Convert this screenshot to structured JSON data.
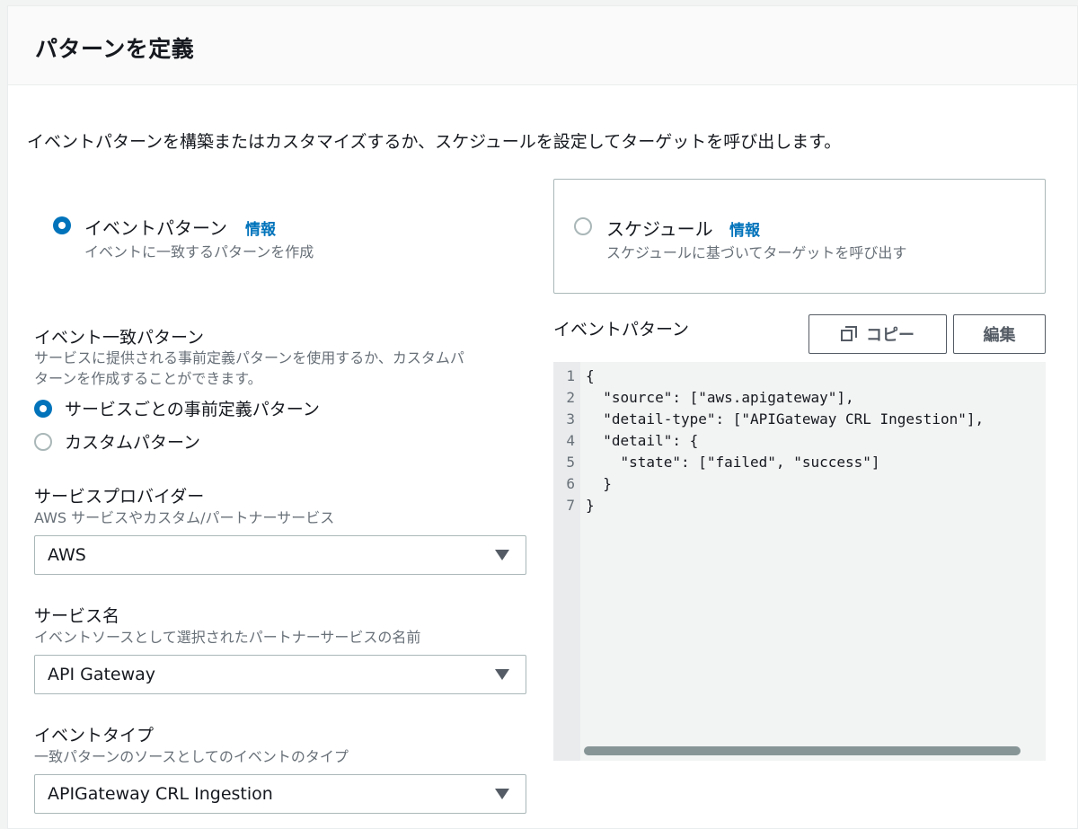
{
  "panel": {
    "title": "パターンを定義"
  },
  "intro": "イベントパターンを構築またはカスタマイズするか、スケジュールを設定してターゲットを呼び出します。",
  "tiles": {
    "event_pattern": {
      "label": "イベントパターン",
      "info": "情報",
      "desc": "イベントに一致するパターンを作成",
      "selected": true
    },
    "schedule": {
      "label": "スケジュール",
      "info": "情報",
      "desc": "スケジュールに基づいてターゲットを呼び出す",
      "selected": false
    }
  },
  "match_pattern": {
    "label": "イベント一致パターン",
    "desc_line1": "サービスに提供される事前定義パターンを使用するか、カスタムパ",
    "desc_line2": "ターンを作成することができます。",
    "options": [
      {
        "label": "サービスごとの事前定義パターン",
        "selected": true
      },
      {
        "label": "カスタムパターン",
        "selected": false
      }
    ]
  },
  "service_provider": {
    "label": "サービスプロバイダー",
    "desc": "AWS サービスやカスタム/パートナーサービス",
    "value": "AWS"
  },
  "service_name": {
    "label": "サービス名",
    "desc": "イベントソースとして選択されたパートナーサービスの名前",
    "value": "API Gateway"
  },
  "event_type": {
    "label": "イベントタイプ",
    "desc": "一致パターンのソースとしてのイベントのタイプ",
    "value": "APIGateway CRL Ingestion"
  },
  "editor": {
    "label": "イベントパターン",
    "copy_label": "コピー",
    "edit_label": "編集",
    "line_numbers": [
      "1",
      "2",
      "3",
      "4",
      "5",
      "6",
      "7"
    ],
    "lines": [
      "{",
      "  \"source\": [\"aws.apigateway\"],",
      "  \"detail-type\": [\"APIGateway CRL Ingestion\"],",
      "  \"detail\": {",
      "    \"state\": [\"failed\", \"success\"]",
      "  }",
      "}"
    ]
  }
}
